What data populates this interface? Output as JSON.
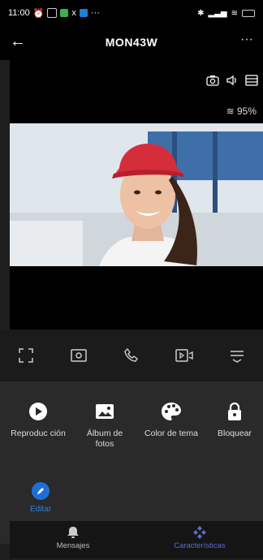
{
  "status_bar": {
    "time": "11:00",
    "extra": "x",
    "dots": "···",
    "battery": ""
  },
  "header": {
    "back_icon": "arrow-left-icon",
    "title": "MON43W",
    "more_label": "···"
  },
  "video": {
    "wifi_level": "95%",
    "icons": [
      "camera-icon",
      "speaker-icon",
      "layout-icon"
    ]
  },
  "controls": [
    "fullscreen-icon",
    "snapshot-icon",
    "phone-icon",
    "record-icon",
    "menu-icon"
  ],
  "features": [
    {
      "label": "Reproduc ción",
      "icon": "play-icon"
    },
    {
      "label": "Álbum de fotos",
      "icon": "image-icon"
    },
    {
      "label": "Color de tema",
      "icon": "palette-icon"
    },
    {
      "label": "Bloquear",
      "icon": "lock-icon"
    }
  ],
  "edit": {
    "label": "Editar",
    "icon": "pencil-icon"
  },
  "tabs": [
    {
      "label": "Mensajes",
      "icon": "bell-icon",
      "active": false
    },
    {
      "label": "Características",
      "icon": "features-icon",
      "active": true
    }
  ],
  "colors": {
    "accent": "#1d6fd8",
    "tab_active": "#5a6cc9"
  }
}
